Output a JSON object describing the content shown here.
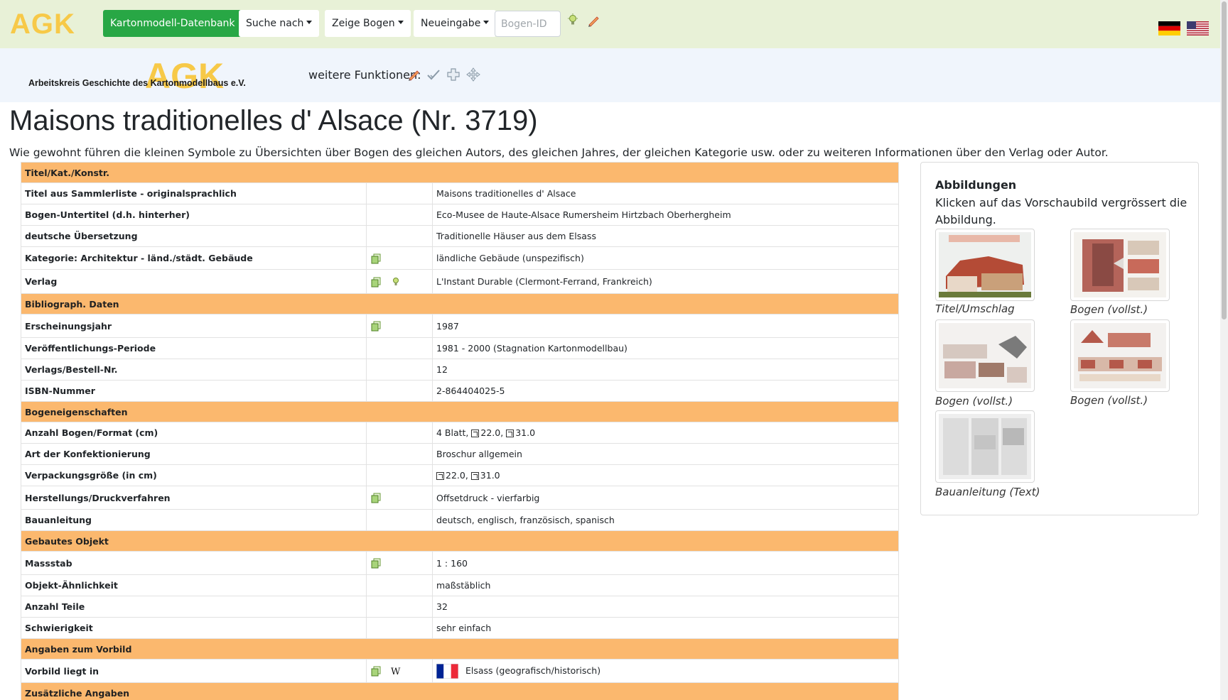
{
  "navbar": {
    "brand": "AGK",
    "db_button": "Kartonmodell-Datenbank",
    "menus": [
      "Suche nach",
      "Zeige Bogen",
      "Neueingabe"
    ],
    "search_placeholder": "Bogen-ID"
  },
  "subbar": {
    "logo_big": "AGK",
    "logo_text": "Arbeitskreis Geschichte des Kartonmodellbaus e.V.",
    "functions_label": "weitere Funktionen:"
  },
  "page": {
    "title": "Maisons traditionelles d' Alsace (Nr. 3719)",
    "intro": "Wie gewohnt führen die kleinen Symbole zu Übersichten über Bogen des gleichen Autors, des gleichen Jahres, der gleichen Kategorie usw. oder zu weiteren Informationen über den Verlag oder Autor."
  },
  "table": {
    "sec1": "Titel/Kat./Konstr.",
    "r1": {
      "label": "Titel aus Sammlerliste - originalsprachlich",
      "value": "Maisons traditionelles d' Alsace"
    },
    "r2": {
      "label": "Bogen-Untertitel (d.h. hinterher)",
      "value": "Eco-Musee de Haute-Alsace Rumersheim Hirtzbach Oberhergheim"
    },
    "r3": {
      "label": "deutsche Übersetzung",
      "value": "Traditionelle Häuser aus dem Elsass"
    },
    "r4": {
      "label": "Kategorie: Architektur - länd./städt. Gebäude",
      "value": "ländliche Gebäude (unspezifisch)"
    },
    "r5": {
      "label": "Verlag",
      "value": "L'Instant Durable (Clermont-Ferrand, Frankreich)"
    },
    "sec2": "Bibliograph. Daten",
    "r6": {
      "label": "Erscheinungsjahr",
      "value": "1987"
    },
    "r7": {
      "label": "Veröffentlichungs-Periode",
      "value": "1981 - 2000 (Stagnation Kartonmodellbau)"
    },
    "r8": {
      "label": "Verlags/Bestell-Nr.",
      "value": "12"
    },
    "r9": {
      "label": "ISBN-Nummer",
      "value": "2-864404025-5"
    },
    "sec3": "Bogeneigenschaften",
    "r10": {
      "label": "Anzahl Bogen/Format (cm)",
      "prefix": "4 Blatt,",
      "h": "22.0,",
      "w": "31.0"
    },
    "r11": {
      "label": "Art der Konfektionierung",
      "value": "Broschur allgemein"
    },
    "r12": {
      "label": "Verpackungsgröße (in cm)",
      "h": "22.0,",
      "w": "31.0"
    },
    "r13": {
      "label": "Herstellungs/Druckverfahren",
      "value": "Offsetdruck - vierfarbig"
    },
    "r14": {
      "label": "Bauanleitung",
      "value": "deutsch, englisch, französisch, spanisch"
    },
    "sec4": "Gebautes Objekt",
    "r15": {
      "label": "Massstab",
      "value": "1 : 160"
    },
    "r16": {
      "label": "Objekt-Ähnlichkeit",
      "value": "maßstäblich"
    },
    "r17": {
      "label": "Anzahl Teile",
      "value": "32"
    },
    "r18": {
      "label": "Schwierigkeit",
      "value": "sehr einfach"
    },
    "sec5": "Angaben zum Vorbild",
    "r19": {
      "label": "Vorbild liegt in",
      "value": "Elsass (geografisch/historisch)"
    },
    "sec6": "Zusätzliche Angaben"
  },
  "panel": {
    "title": "Abbildungen",
    "subtitle": "Klicken auf das Vorschaubild vergrössert die Abbildung.",
    "captions": [
      "Titel/Umschlag",
      "Bogen (vollst.)",
      "Bogen (vollst.)",
      "Bogen (vollst.)",
      "Bauanleitung (Text)"
    ]
  },
  "colors": {
    "navbar_bg": "#e8f1d7",
    "subbar_bg": "#f0f5fc",
    "section_bg": "#fbb86e",
    "button_green": "#28a745",
    "logo_yellow": "#f7c948"
  },
  "icons": [
    "bulb-icon",
    "pencil-icon",
    "check-icon",
    "plus-icon",
    "move-icon",
    "copy-icon",
    "wikipedia-icon",
    "flag-de-icon",
    "flag-us-icon",
    "flag-fr-icon"
  ]
}
